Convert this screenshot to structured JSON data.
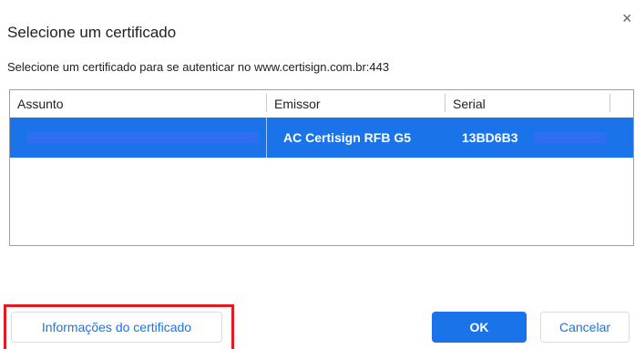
{
  "dialog": {
    "title": "Selecione um certificado",
    "subtitle": "Selecione um certificado para se autenticar no www.certisign.com.br:443",
    "close_icon": "close-icon",
    "close_glyph": "×"
  },
  "table": {
    "columns": [
      "Assunto",
      "Emissor",
      "Serial"
    ],
    "rows": [
      {
        "subject": "",
        "issuer": "AC Certisign RFB G5",
        "serial": "13BD6B3",
        "selected": true
      }
    ]
  },
  "buttons": {
    "info_label": "Informações do certificado",
    "ok_label": "OK",
    "cancel_label": "Cancelar"
  },
  "colors": {
    "accent": "#1a73e8",
    "highlight": "#e01b24",
    "redaction": "#2f6ef1"
  }
}
